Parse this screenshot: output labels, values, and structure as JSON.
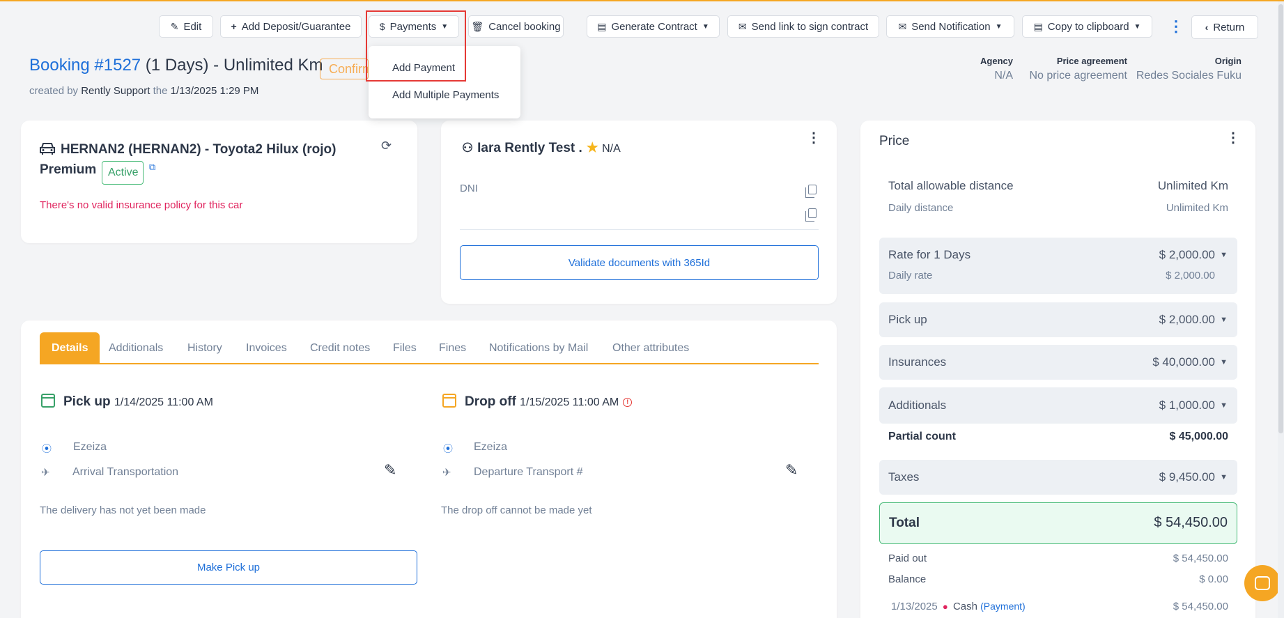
{
  "toolbar": {
    "edit": "Edit",
    "add_deposit": "Add Deposit/Guarantee",
    "payments": "Payments",
    "cancel_booking": "Cancel booking",
    "generate_contract": "Generate Contract",
    "send_link": "Send link to sign contract",
    "send_notification": "Send Notification",
    "copy_clipboard": "Copy to clipboard",
    "return": "Return"
  },
  "payments_menu": {
    "items": [
      "Add Payment",
      "Add Multiple Payments"
    ]
  },
  "header": {
    "booking_number": "Booking #1527",
    "booking_rest": " (1 Days) - Unlimited Km",
    "status": "Confirmed",
    "created_by_prefix": "created by",
    "created_by": "Rently Support",
    "the": "the",
    "created_at": "1/13/2025 1:29 PM"
  },
  "meta": {
    "agency_label": "Agency",
    "agency_value": "N/A",
    "price_agreement_label": "Price agreement",
    "price_agreement_value": "No price agreement",
    "origin_label": "Origin",
    "origin_value": "Redes Sociales Fuku"
  },
  "car": {
    "title": "HERNAN2 (HERNAN2) - Toyota2 Hilux (rojo) Premium",
    "status": "Active",
    "warning": "There's no valid insurance policy for this car"
  },
  "client": {
    "name": "Iara Rently Test .",
    "rating": "N/A",
    "dni_label": "DNI",
    "validate_button": "Validate documents with 365Id"
  },
  "tabs": [
    "Details",
    "Additionals",
    "History",
    "Invoices",
    "Credit notes",
    "Files",
    "Fines",
    "Notifications by Mail",
    "Other attributes"
  ],
  "pickup": {
    "label": "Pick up",
    "datetime": "1/14/2025 11:00 AM",
    "location": "Ezeiza",
    "transport": "Arrival Transportation",
    "status": "The delivery has not yet been made",
    "button": "Make Pick up"
  },
  "dropoff": {
    "label": "Drop off",
    "datetime": "1/15/2025 11:00 AM",
    "location": "Ezeiza",
    "transport": "Departure Transport #",
    "status": "The drop off cannot be made yet"
  },
  "price": {
    "title": "Price",
    "total_distance_label": "Total allowable distance",
    "total_distance_value": "Unlimited Km",
    "daily_distance_label": "Daily distance",
    "daily_distance_value": "Unlimited Km",
    "rate_label": "Rate for 1 Days",
    "rate_value": "$ 2,000.00",
    "daily_rate_label": "Daily rate",
    "daily_rate_value": "$ 2,000.00",
    "pickup_label": "Pick up",
    "pickup_value": "$ 2,000.00",
    "insurances_label": "Insurances",
    "insurances_value": "$ 40,000.00",
    "additionals_label": "Additionals",
    "additionals_value": "$ 1,000.00",
    "partial_label": "Partial count",
    "partial_value": "$ 45,000.00",
    "taxes_label": "Taxes",
    "taxes_value": "$ 9,450.00",
    "total_label": "Total",
    "total_value": "$ 54,450.00",
    "paid_label": "Paid out",
    "paid_value": "$ 54,450.00",
    "balance_label": "Balance",
    "balance_value": "$ 0.00",
    "payment_date": "1/13/2025",
    "payment_method": "Cash",
    "payment_type": "(Payment)",
    "payment_amount": "$ 54,450.00"
  },
  "colors": {
    "accent": "#f5a623",
    "link": "#1e6fd9",
    "success": "#38a169",
    "danger": "#e0245e"
  }
}
